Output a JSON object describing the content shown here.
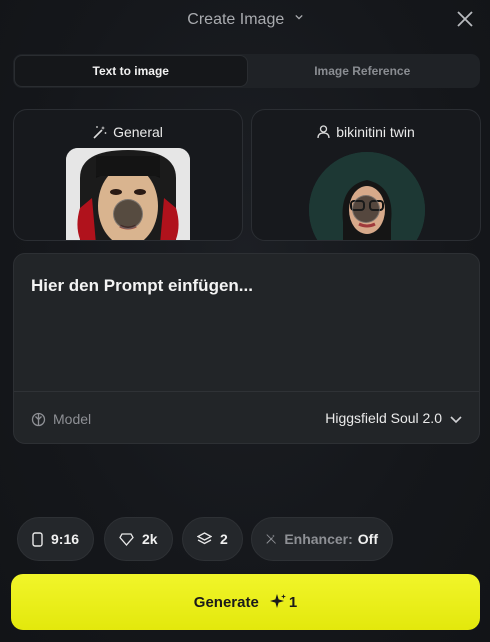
{
  "header": {
    "title": "Create Image",
    "title_chevron_icon": "chevron-down-icon",
    "close_icon": "close-icon"
  },
  "tabs": [
    {
      "label": "Text to image",
      "active": true
    },
    {
      "label": "Image Reference",
      "active": false
    }
  ],
  "style_card": {
    "icon": "magic-wand-icon",
    "label": "General"
  },
  "character_card": {
    "icon": "user-icon",
    "label": "bikinitini twin"
  },
  "prompt": {
    "placeholder": "Hier den Prompt einfügen...",
    "model_icon": "model-icon",
    "model_label": "Model",
    "model_value": "Higgsfield Soul 2.0"
  },
  "options": {
    "aspect": {
      "icon": "phone-icon",
      "value": "9:16"
    },
    "quality": {
      "icon": "diamond-icon",
      "value": "2k"
    },
    "count": {
      "icon": "layers-icon",
      "value": "2"
    },
    "enhancer": {
      "icon": "wand-off-icon",
      "label": "Enhancer:",
      "value": "Off"
    }
  },
  "generate": {
    "label": "Generate",
    "icon": "sparkle-icon",
    "cost": "1"
  },
  "colors": {
    "accent": "#e9ee14",
    "background": "#16181c"
  }
}
